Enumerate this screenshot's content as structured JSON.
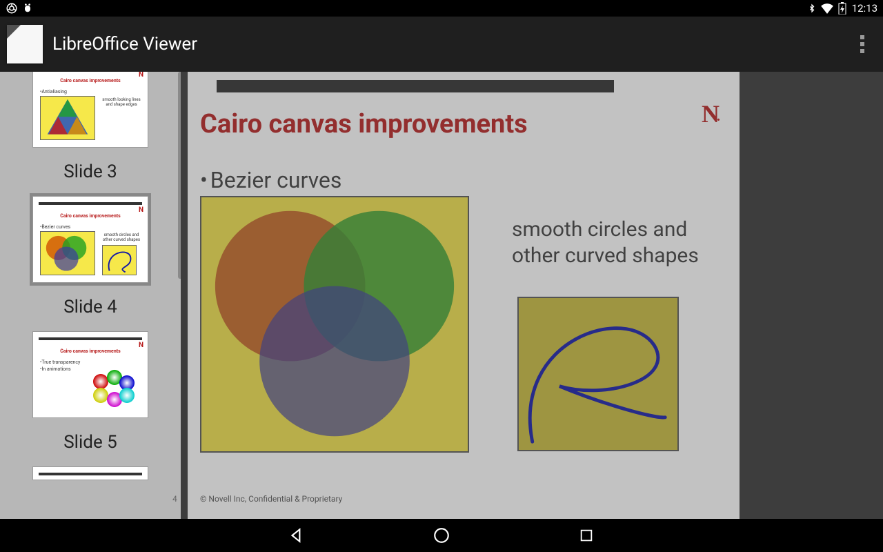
{
  "status_bar": {
    "time": "12:13"
  },
  "app_bar": {
    "title": "LibreOffice Viewer"
  },
  "sidebar": {
    "slides": [
      {
        "label": "Slide 3",
        "title": "Cairo canvas improvements",
        "bullet": "•Antialiasing",
        "caption": "smooth looking lines and shape edges"
      },
      {
        "label": "Slide 4",
        "title": "Cairo canvas improvements",
        "bullet": "•Bezier curves",
        "caption": "smooth circles and other curved shapes"
      },
      {
        "label": "Slide 5",
        "title": "Cairo canvas improvements",
        "bullet": "•True transparency",
        "bullet2": "•In animations"
      }
    ]
  },
  "main_slide": {
    "title": "Cairo canvas improvements",
    "bullet": "Bezier curves",
    "caption": "smooth circles and other curved shapes",
    "logo": "N",
    "page_num": "4",
    "footer": "©   Novell Inc, Confidential & Proprietary"
  }
}
